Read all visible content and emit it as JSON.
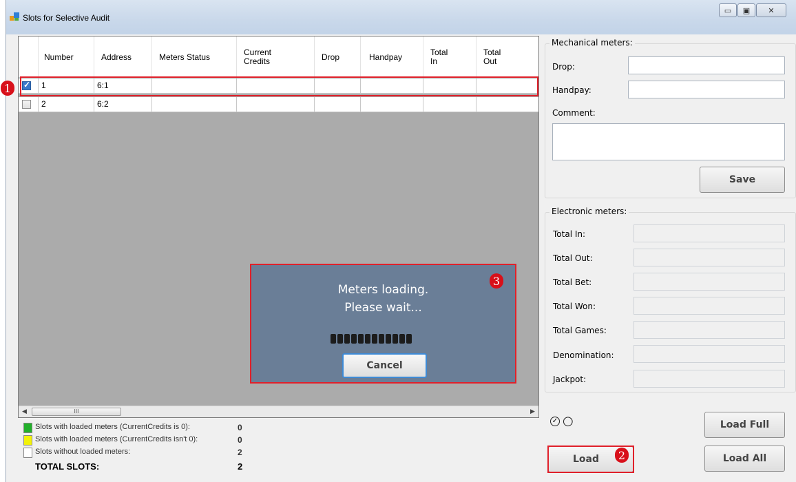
{
  "window": {
    "title": "Slots for Selective Audit",
    "controls": {
      "minimize": "▭",
      "maximize": "▣",
      "close": "✕"
    }
  },
  "grid": {
    "headers": [
      "Number",
      "Address",
      "Meters Status",
      "Current\nCredits",
      "Drop",
      "Handpay",
      "Total\nIn",
      "Total\nOut"
    ],
    "rows": [
      {
        "checked": true,
        "number": "1",
        "address": "6:1"
      },
      {
        "checked": false,
        "number": "2",
        "address": "6:2"
      }
    ],
    "scroll_thumb_glyph": "III"
  },
  "annotations": {
    "one": "1",
    "two": "2",
    "three": "3"
  },
  "loading": {
    "line1": "Meters loading.",
    "line2": "Please wait...",
    "cancel_label": "Cancel"
  },
  "mechanical": {
    "title": "Mechanical meters:",
    "drop_label": "Drop:",
    "handpay_label": "Handpay:",
    "comment_label": "Comment:",
    "save_label": "Save"
  },
  "electronic": {
    "title": "Electronic meters:",
    "labels": [
      "Total In:",
      "Total Out:",
      "Total Bet:",
      "Total Won:",
      "Total Games:",
      "Denomination:",
      "Jackpot:"
    ]
  },
  "buttons": {
    "load_full": "Load Full",
    "load": "Load",
    "load_all": "Load All"
  },
  "status_icons": {
    "check": "✓",
    "circle": "○"
  },
  "legend": {
    "items": [
      {
        "color": "#22b02a",
        "label": "Slots with loaded meters (CurrentCredits is 0):",
        "value": "0"
      },
      {
        "color": "#f2f20a",
        "label": "Slots with loaded meters (CurrentCredits isn't 0):",
        "value": "0"
      },
      {
        "color": "#ffffff",
        "label": "Slots without loaded meters:",
        "value": "2"
      }
    ],
    "total_label": "TOTAL SLOTS:",
    "total_value": "2"
  }
}
